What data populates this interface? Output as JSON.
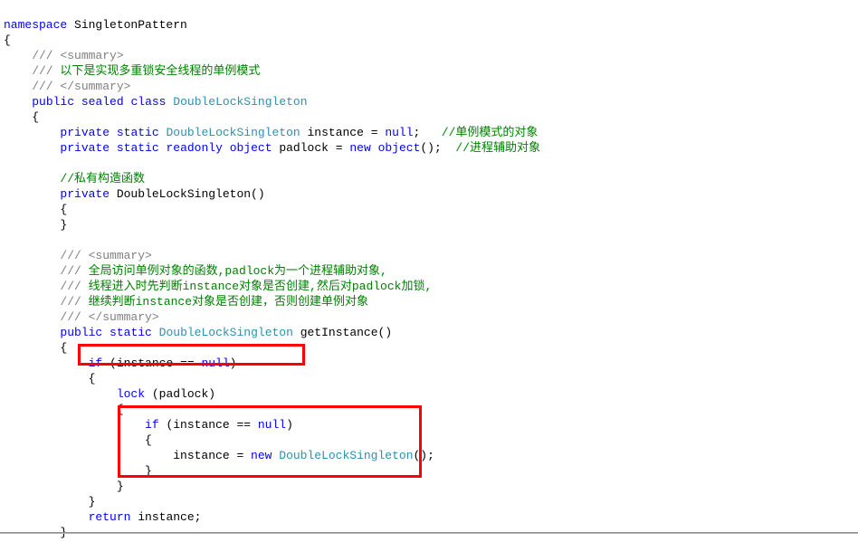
{
  "code": {
    "l1_kw1": "namespace",
    "l1_plain": " SingletonPattern",
    "l2_plain": "{",
    "l3_gray1": "    /// ",
    "l3_gray2": "<summary>",
    "l4_gray1": "    ///",
    "l4_com": " 以下是实现多重锁安全线程的单例模式",
    "l5_gray1": "    /// ",
    "l5_gray2": "</summary>",
    "l6_pad": "    ",
    "l6_kw1": "public",
    "l6_sp1": " ",
    "l6_kw2": "sealed",
    "l6_sp2": " ",
    "l6_kw3": "class",
    "l6_sp3": " ",
    "l6_cls": "DoubleLockSingleton",
    "l7_plain": "    {",
    "l8_pad": "        ",
    "l8_kw1": "private",
    "l8_sp1": " ",
    "l8_kw2": "static",
    "l8_sp2": " ",
    "l8_cls": "DoubleLockSingleton",
    "l8_plain1": " instance = ",
    "l8_kw3": "null",
    "l8_plain2": ";   ",
    "l8_com": "//单例模式的对象",
    "l9_pad": "        ",
    "l9_kw1": "private",
    "l9_sp1": " ",
    "l9_kw2": "static",
    "l9_sp2": " ",
    "l9_kw3": "readonly",
    "l9_sp3": " ",
    "l9_kw4": "object",
    "l9_plain1": " padlock = ",
    "l9_kw5": "new",
    "l9_sp5": " ",
    "l9_kw6": "object",
    "l9_plain2": "();  ",
    "l9_com": "//进程辅助对象",
    "l11_pad": "        ",
    "l11_com": "//私有构造函数",
    "l12_pad": "        ",
    "l12_kw1": "private",
    "l12_plain1": " DoubleLockSingleton()",
    "l13_plain": "        {",
    "l14_plain": "        }",
    "l16_gray1": "        /// ",
    "l16_gray2": "<summary>",
    "l17_gray1": "        ///",
    "l17_com": " 全局访问单例对象的函数,padlock为一个进程辅助对象,",
    "l18_gray1": "        ///",
    "l18_com": " 线程进入时先判断instance对象是否创建,然后对padlock加锁,",
    "l19_gray1": "        ///",
    "l19_com": " 继续判断instance对象是否创建，否则创建单例对象",
    "l20_gray1": "        /// ",
    "l20_gray2": "</summary>",
    "l21_pad": "        ",
    "l21_kw1": "public",
    "l21_sp1": " ",
    "l21_kw2": "static",
    "l21_sp2": " ",
    "l21_cls": "DoubleLockSingleton",
    "l21_plain1": " getInstance()",
    "l22_plain": "        {",
    "l23_pad": "            ",
    "l23_kw1": "if",
    "l23_plain1": " (instance == ",
    "l23_kw2": "null",
    "l23_plain2": ")",
    "l24_plain": "            {",
    "l25_pad": "                ",
    "l25_kw1": "lock",
    "l25_plain1": " (padlock)",
    "l26_plain": "                {",
    "l27_pad": "                    ",
    "l27_kw1": "if",
    "l27_plain1": " (instance == ",
    "l27_kw2": "null",
    "l27_plain2": ")",
    "l28_plain": "                    {",
    "l29_pad": "                        instance = ",
    "l29_kw1": "new",
    "l29_sp1": " ",
    "l29_cls": "DoubleLockSingleton",
    "l29_plain1": "();",
    "l30_plain": "                    }",
    "l31_plain": "                }",
    "l32_plain": "            }",
    "l33_pad": "            ",
    "l33_kw1": "return",
    "l33_plain1": " instance;",
    "l34_plain": "        }"
  }
}
